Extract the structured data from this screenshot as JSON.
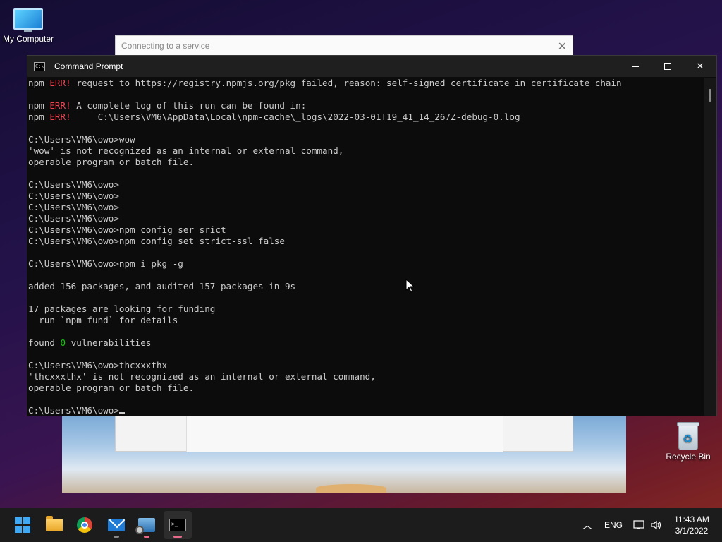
{
  "desktop": {
    "icons": [
      {
        "label": "My Computer"
      },
      {
        "label": "Recycle Bin"
      }
    ]
  },
  "background_window": {
    "title": "Connecting to a service"
  },
  "cmd_window": {
    "title": "Command Prompt",
    "console_lines": [
      [
        {
          "t": "npm "
        },
        {
          "t": "ERR!",
          "c": "red"
        },
        {
          "t": " request to https://registry.npmjs.org/pkg failed, reason: self-signed certificate in certificate chain"
        }
      ],
      [],
      [
        {
          "t": "npm "
        },
        {
          "t": "ERR!",
          "c": "red"
        },
        {
          "t": " A complete log of this run can be found in:"
        }
      ],
      [
        {
          "t": "npm "
        },
        {
          "t": "ERR!",
          "c": "red"
        },
        {
          "t": "     C:\\Users\\VM6\\AppData\\Local\\npm-cache\\_logs\\2022-03-01T19_41_14_267Z-debug-0.log"
        }
      ],
      [],
      [
        {
          "t": "C:\\Users\\VM6\\owo>wow"
        }
      ],
      [
        {
          "t": "'wow' is not recognized as an internal or external command,"
        }
      ],
      [
        {
          "t": "operable program or batch file."
        }
      ],
      [],
      [
        {
          "t": "C:\\Users\\VM6\\owo>"
        }
      ],
      [
        {
          "t": "C:\\Users\\VM6\\owo>"
        }
      ],
      [
        {
          "t": "C:\\Users\\VM6\\owo>"
        }
      ],
      [
        {
          "t": "C:\\Users\\VM6\\owo>"
        }
      ],
      [
        {
          "t": "C:\\Users\\VM6\\owo>npm config ser srict"
        }
      ],
      [
        {
          "t": "C:\\Users\\VM6\\owo>npm config set strict-ssl false"
        }
      ],
      [],
      [
        {
          "t": "C:\\Users\\VM6\\owo>npm i pkg -g"
        }
      ],
      [],
      [
        {
          "t": "added 156 packages, and audited 157 packages in 9s"
        }
      ],
      [],
      [
        {
          "t": "17 packages are looking for funding"
        }
      ],
      [
        {
          "t": "  run `npm fund` for details"
        }
      ],
      [],
      [
        {
          "t": "found "
        },
        {
          "t": "0",
          "c": "grn"
        },
        {
          "t": " vulnerabilities"
        }
      ],
      [],
      [
        {
          "t": "C:\\Users\\VM6\\owo>thcxxxthx"
        }
      ],
      [
        {
          "t": "'thcxxxthx' is not recognized as an internal or external command,"
        }
      ],
      [
        {
          "t": "operable program or batch file."
        }
      ],
      [],
      [
        {
          "t": "C:\\Users\\VM6\\owo>"
        },
        {
          "cursor": true
        }
      ]
    ]
  },
  "taskbar": {
    "apps": [
      {
        "icon": "start-icon"
      },
      {
        "icon": "file-explorer-icon"
      },
      {
        "icon": "chrome-icon"
      },
      {
        "icon": "mail-icon"
      },
      {
        "icon": "remote-desktop-icon"
      },
      {
        "icon": "command-prompt-icon"
      }
    ],
    "language": "ENG",
    "time": "11:43 AM",
    "date": "3/1/2022"
  },
  "colors": {
    "console_bg": "#0c0c0c",
    "console_text": "#cccccc",
    "error_red": "#e74856",
    "ok_green": "#16c60c"
  }
}
